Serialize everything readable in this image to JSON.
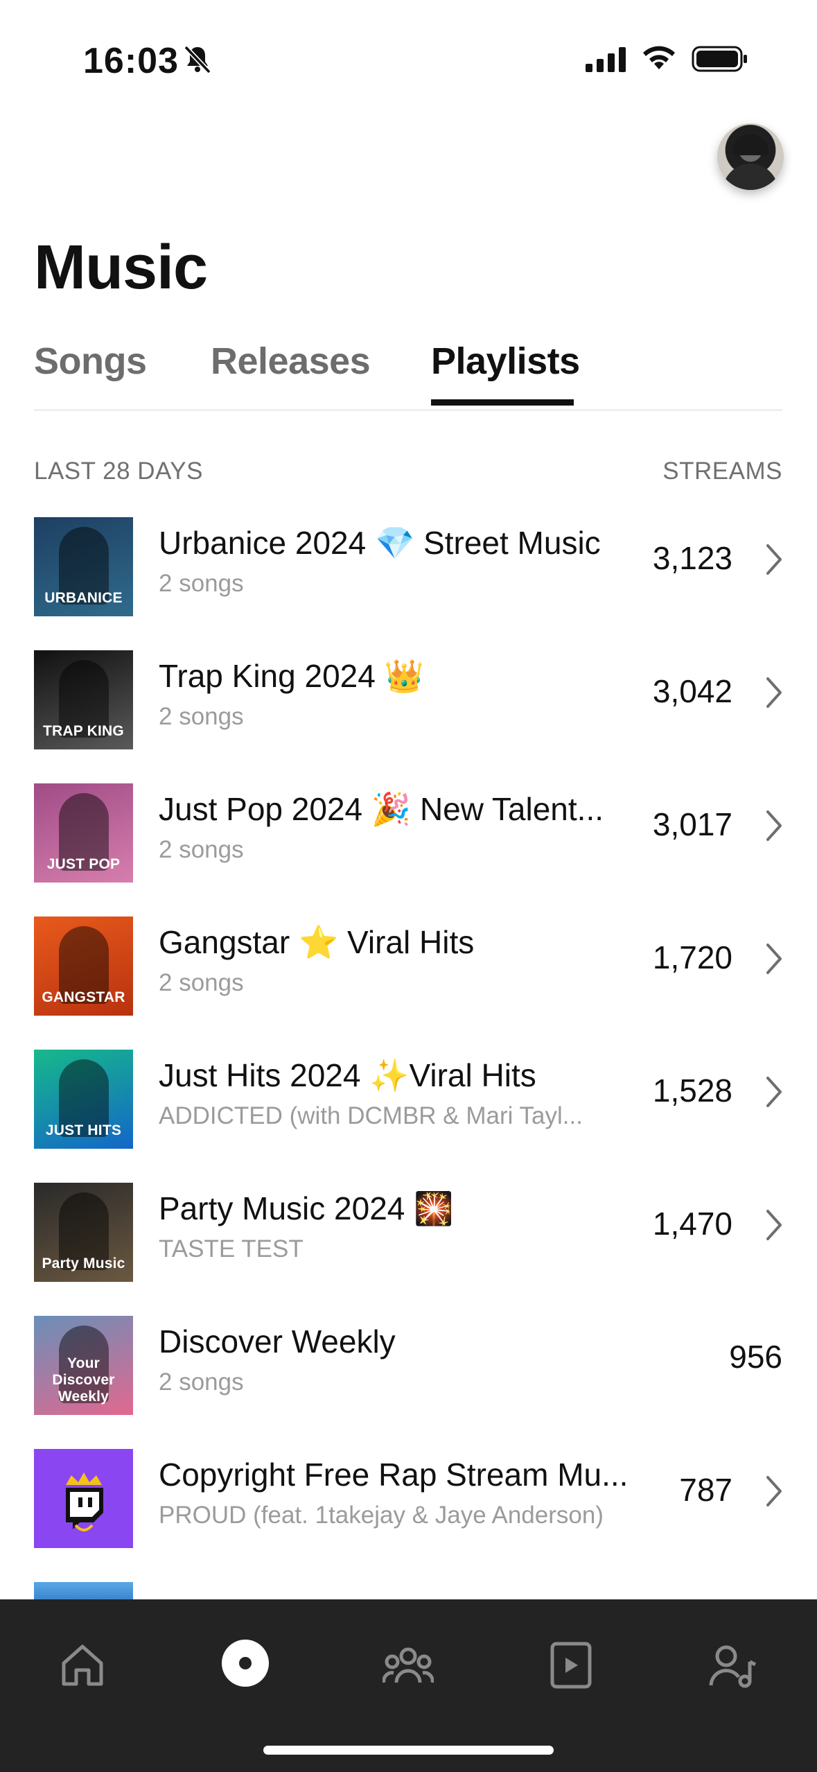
{
  "status": {
    "time": "16:03"
  },
  "page": {
    "title": "Music"
  },
  "tabs": {
    "songs": "Songs",
    "releases": "Releases",
    "playlists": "Playlists",
    "active": "playlists"
  },
  "list_header": {
    "period": "LAST 28 DAYS",
    "metric": "STREAMS"
  },
  "playlists": [
    {
      "name": "Urbanice 2024 💎 Street Music",
      "sub": "2 songs",
      "streams": "3,123",
      "cover_label": "URBANICE",
      "cover_colors": [
        "#1e3f62",
        "#2f6b8c"
      ]
    },
    {
      "name": "Trap King 2024 👑",
      "sub": "2 songs",
      "streams": "3,042",
      "cover_label": "TRAP KING",
      "cover_colors": [
        "#111111",
        "#5a5a5a"
      ]
    },
    {
      "name": "Just Pop 2024 🎉 New Talent...",
      "sub": "2 songs",
      "streams": "3,017",
      "cover_label": "JUST POP",
      "cover_colors": [
        "#a04c86",
        "#d67fae"
      ]
    },
    {
      "name": "Gangstar ⭐ Viral Hits",
      "sub": "2 songs",
      "streams": "1,720",
      "cover_label": "GANGSTAR",
      "cover_colors": [
        "#e85a1c",
        "#b8320f"
      ]
    },
    {
      "name": "Just Hits 2024 ✨Viral Hits",
      "sub": "ADDICTED (with DCMBR & Mari Tayl...",
      "streams": "1,528",
      "cover_label": "JUST HITS",
      "cover_colors": [
        "#17b98a",
        "#1466c8"
      ]
    },
    {
      "name": "Party Music 2024 🎇",
      "sub": "TASTE TEST",
      "streams": "1,470",
      "cover_label": "Party Music",
      "cover_colors": [
        "#2a2a2a",
        "#6b5840"
      ]
    },
    {
      "name": "Discover Weekly",
      "sub": "2 songs",
      "streams": "956",
      "cover_label": "Your Discover Weekly",
      "cover_colors": [
        "#6a8fb8",
        "#e2688f"
      ]
    },
    {
      "name": "Copyright Free Rap Stream Mu...",
      "sub": "PROUD (feat. 1takejay & Jaye Anderson)",
      "streams": "787",
      "cover_label": "",
      "cover_colors": [
        "#8a46f0",
        "#8a46f0"
      ]
    }
  ],
  "tabbar": {
    "items": [
      "home-icon",
      "music-disc-icon",
      "audience-icon",
      "video-icon",
      "artist-profile-icon"
    ],
    "active": "music-disc-icon"
  },
  "colors": {
    "accent": "#111111",
    "muted": "#9b9b9b",
    "tabbar_bg": "#232323"
  }
}
